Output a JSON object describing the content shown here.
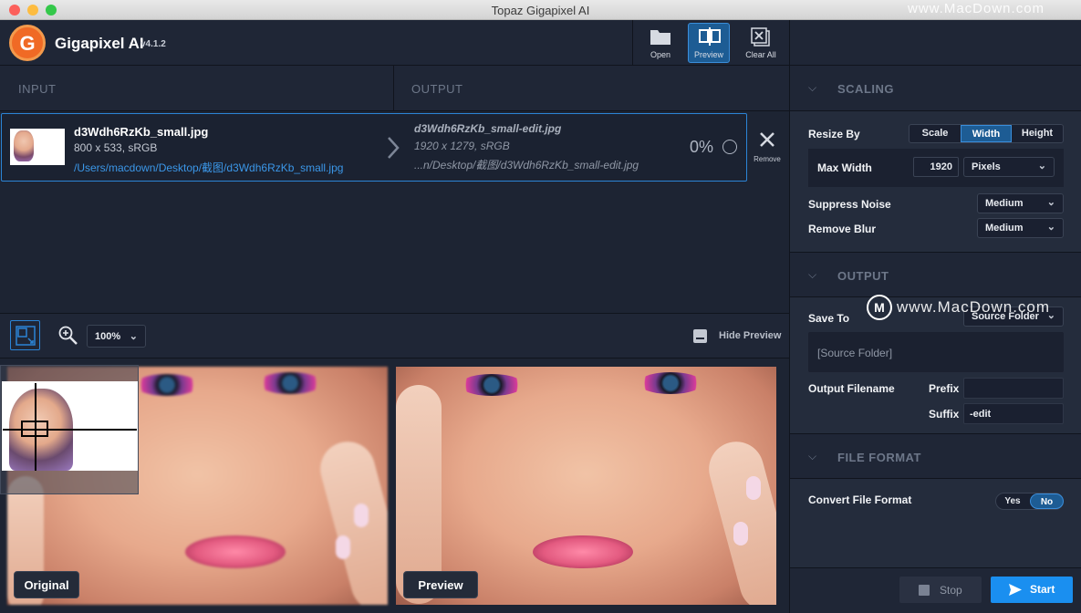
{
  "window": {
    "title": "Topaz Gigapixel AI",
    "watermark_top": "www.MacDown.com",
    "watermark_mid": "www.MacDown.com"
  },
  "app": {
    "name": "Gigapixel AI",
    "version": "v4.1.2",
    "logo_letter": "G"
  },
  "toolbar": {
    "open_label": "Open",
    "preview_label": "Preview",
    "clear_all_label": "Clear All"
  },
  "columns": {
    "input": "INPUT",
    "output": "OUTPUT"
  },
  "file": {
    "input_name": "d3Wdh6RzKb_small.jpg",
    "input_info": "800 x 533, sRGB",
    "input_path": "/Users/macdown/Desktop/截图/d3Wdh6RzKb_small.jpg",
    "output_name": "d3Wdh6RzKb_small-edit.jpg",
    "output_info": "1920 x 1279, sRGB",
    "output_path": "...n/Desktop/截图/d3Wdh6RzKb_small-edit.jpg",
    "progress": "0%",
    "remove_label": "Remove"
  },
  "preview_bar": {
    "zoom": "100%",
    "hide_preview_label": "Hide Preview"
  },
  "preview": {
    "original_label": "Original",
    "preview_label": "Preview"
  },
  "panel": {
    "scaling": {
      "title": "SCALING",
      "resize_by_label": "Resize By",
      "resize_options": [
        "Scale",
        "Width",
        "Height"
      ],
      "resize_selected": "Width",
      "max_width_label": "Max Width",
      "max_width_value": "1920",
      "unit": "Pixels",
      "suppress_noise_label": "Suppress Noise",
      "suppress_noise_value": "Medium",
      "remove_blur_label": "Remove Blur",
      "remove_blur_value": "Medium"
    },
    "output": {
      "title": "OUTPUT",
      "save_to_label": "Save To",
      "save_to_value": "Source Folder",
      "folder_display": "[Source Folder]",
      "output_filename_label": "Output Filename",
      "prefix_label": "Prefix",
      "prefix_value": "",
      "suffix_label": "Suffix",
      "suffix_value": "-edit"
    },
    "file_format": {
      "title": "FILE FORMAT",
      "convert_label": "Convert File Format",
      "yes_label": "Yes",
      "no_label": "No",
      "selected": "No"
    }
  },
  "actions": {
    "stop_label": "Stop",
    "start_label": "Start"
  },
  "colors": {
    "accent": "#2b84d6",
    "start_button": "#1a8ff0",
    "background": "#1d2433",
    "panel": "#242c3c"
  }
}
